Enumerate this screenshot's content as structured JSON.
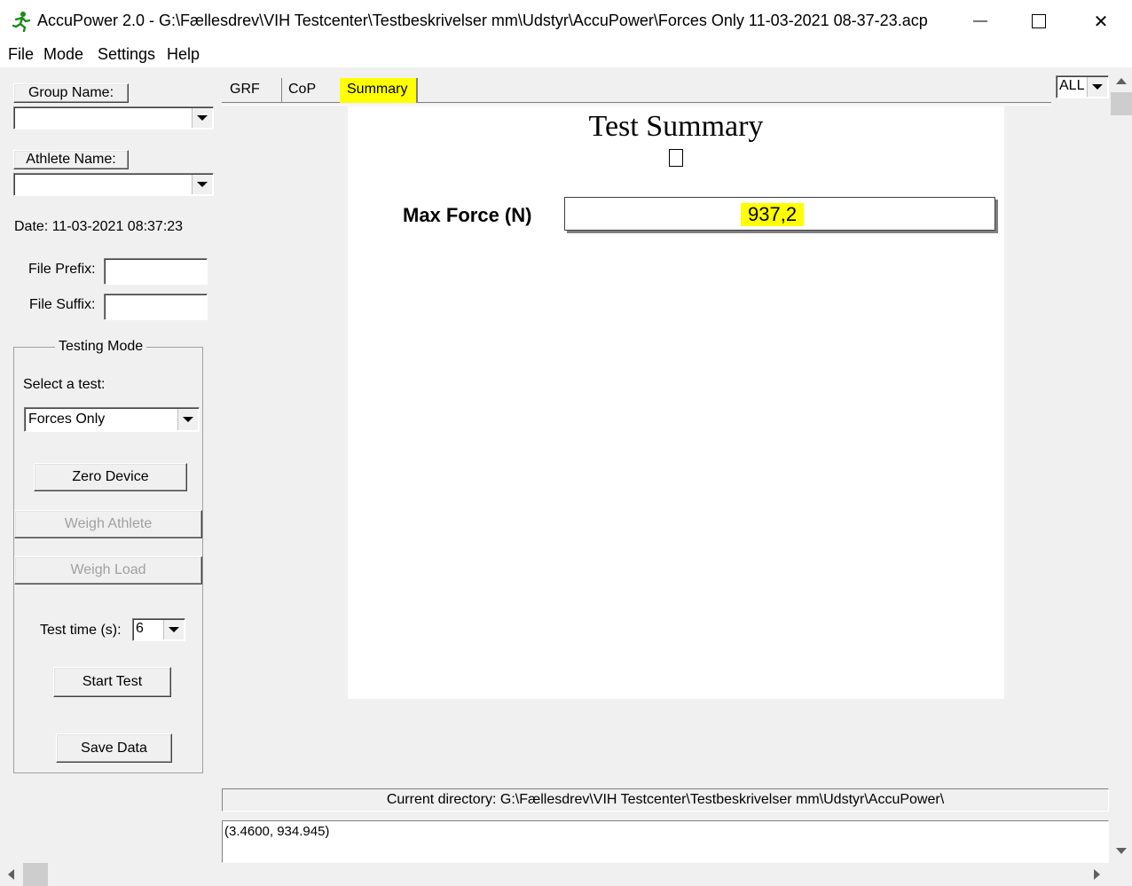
{
  "window": {
    "title": "AccuPower 2.0  -  G:\\Fællesdrev\\VIH Testcenter\\Testbeskrivelser mm\\Udstyr\\AccuPower\\Forces Only 11-03-2021  08-37-23.acp",
    "minimize_glyph": "—",
    "maximize_glyph": "☐",
    "close_glyph": "✕"
  },
  "menu": [
    "File",
    "Mode",
    "Settings",
    "Help"
  ],
  "left": {
    "group_name_label": "Group Name:",
    "group_name_value": "",
    "athlete_name_label": "Athlete Name:",
    "athlete_name_value": "",
    "date_text": "Date: 11-03-2021  08:37:23",
    "file_prefix_label": "File Prefix:",
    "file_prefix_value": "",
    "file_suffix_label": "File Suffix:",
    "file_suffix_value": "",
    "testing_mode_title": "Testing Mode",
    "select_test_label": "Select a test:",
    "select_test_value": "Forces Only",
    "zero_device": "Zero Device",
    "weigh_athlete": "Weigh Athlete",
    "weigh_load": "Weigh Load",
    "test_time_label": "Test time (s):",
    "test_time_value": "6",
    "start_test": "Start Test",
    "save_data": "Save Data"
  },
  "tabs": [
    "GRF",
    "CoP",
    "Summary"
  ],
  "active_tab": "Summary",
  "view_select": "ALL",
  "summary": {
    "title": "Test Summary",
    "max_force_label": "Max Force (N)",
    "max_force_value": "937,2"
  },
  "status": {
    "current_directory": "Current directory: G:\\Fællesdrev\\VIH Testcenter\\Testbeskrivelser mm\\Udstyr\\AccuPower\\",
    "coordinates": "(3.4600, 934.945)"
  },
  "colors": {
    "highlight": "#ffff00",
    "window_bg": "#f0f0f0",
    "icon_green": "#1a8a1a"
  }
}
